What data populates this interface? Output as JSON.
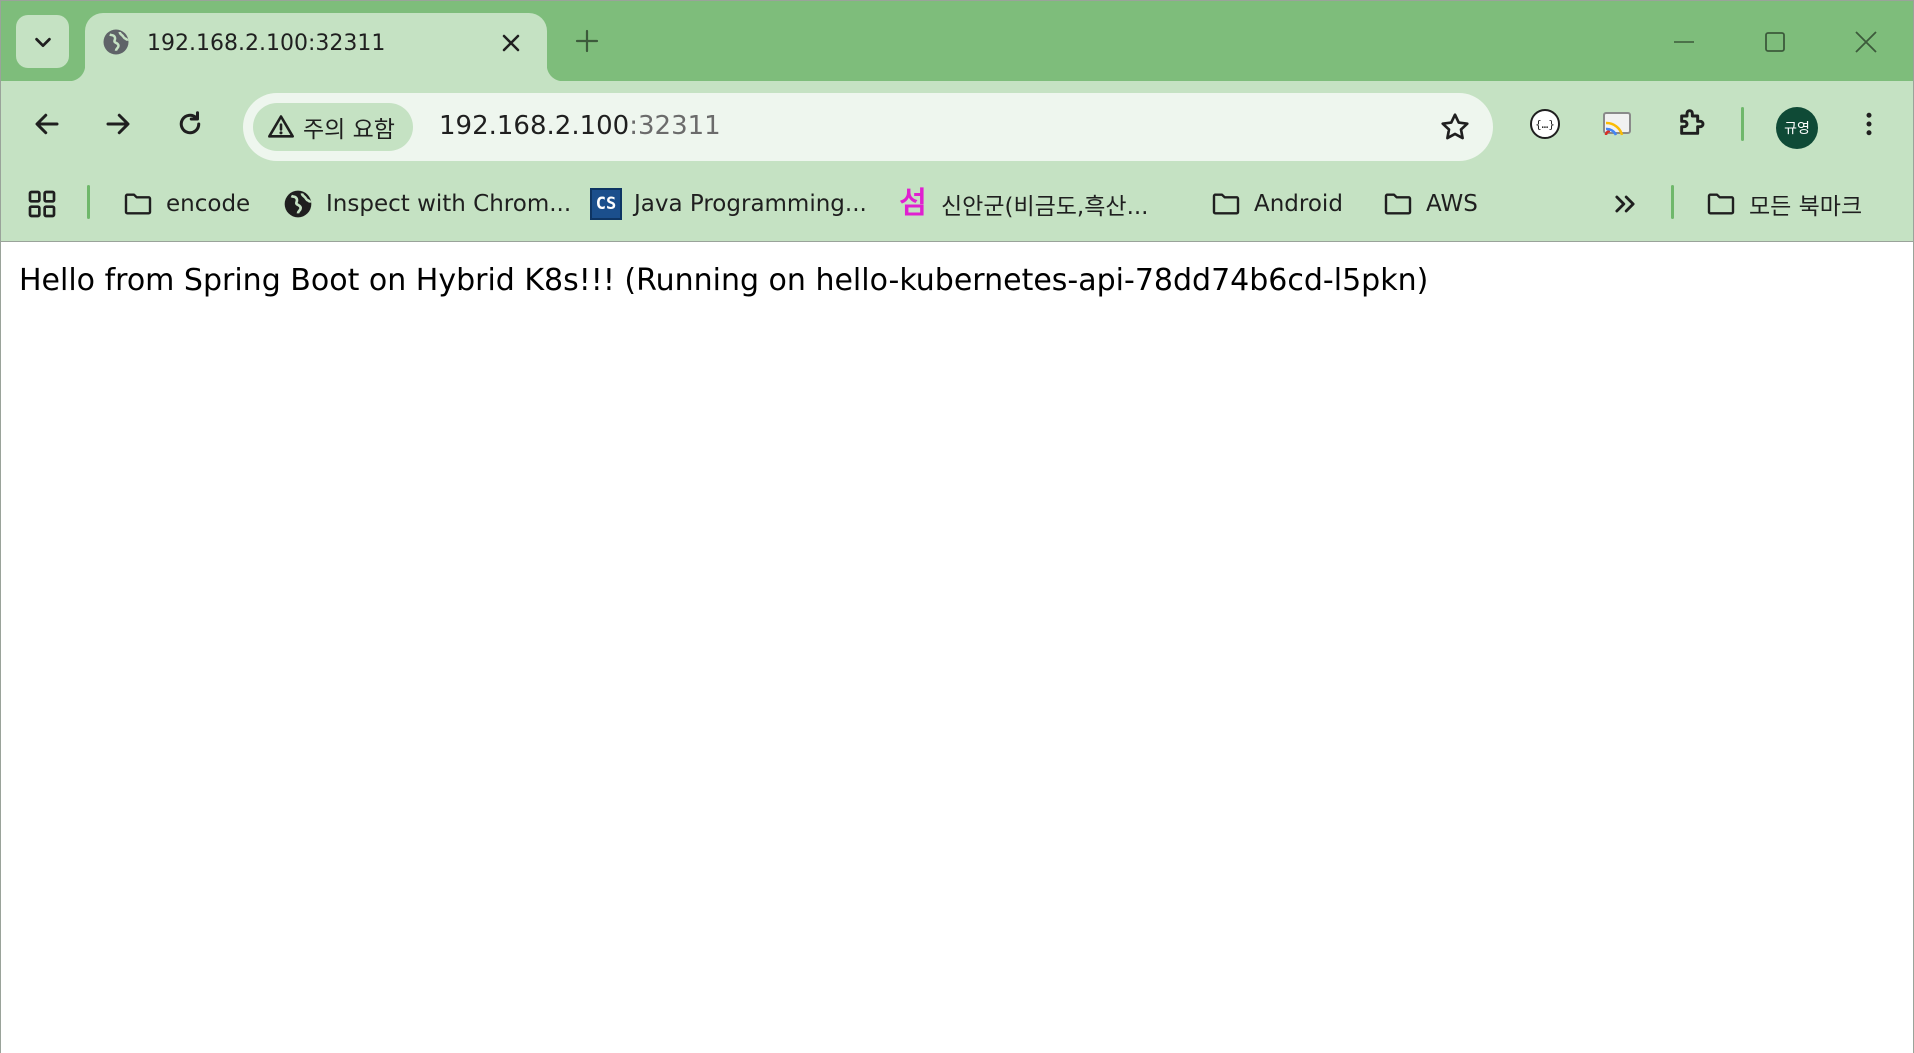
{
  "tab": {
    "title": "192.168.2.100:32311"
  },
  "toolbar": {
    "security_chip": "주의 요함",
    "url_host": "192.168.2.100",
    "url_port": ":32311",
    "profile_initials": "규영"
  },
  "bookmarks": {
    "items": [
      {
        "label": "encode",
        "icon": "folder-icon"
      },
      {
        "label": "Inspect with Chrom...",
        "icon": "globe-icon"
      },
      {
        "label": "Java Programming...",
        "icon": "cs-icon",
        "icon_text": "CS"
      },
      {
        "label": "신안군(비금도,흑산...",
        "icon": "seom-icon",
        "icon_text": "섬"
      },
      {
        "label": "Android",
        "icon": "folder-icon"
      },
      {
        "label": "AWS",
        "icon": "folder-icon"
      }
    ],
    "all_bookmarks": "모든 북마크"
  },
  "page": {
    "text": "Hello from Spring Boot on Hybrid K8s!!! (Running on hello-kubernetes-api-78dd74b6cd-l5pkn)"
  },
  "colors": {
    "tabstrip": "#7ebd7b",
    "toolbar": "#c5e2c3",
    "omnibox": "#eef6ee",
    "avatar": "#0f4a36"
  }
}
